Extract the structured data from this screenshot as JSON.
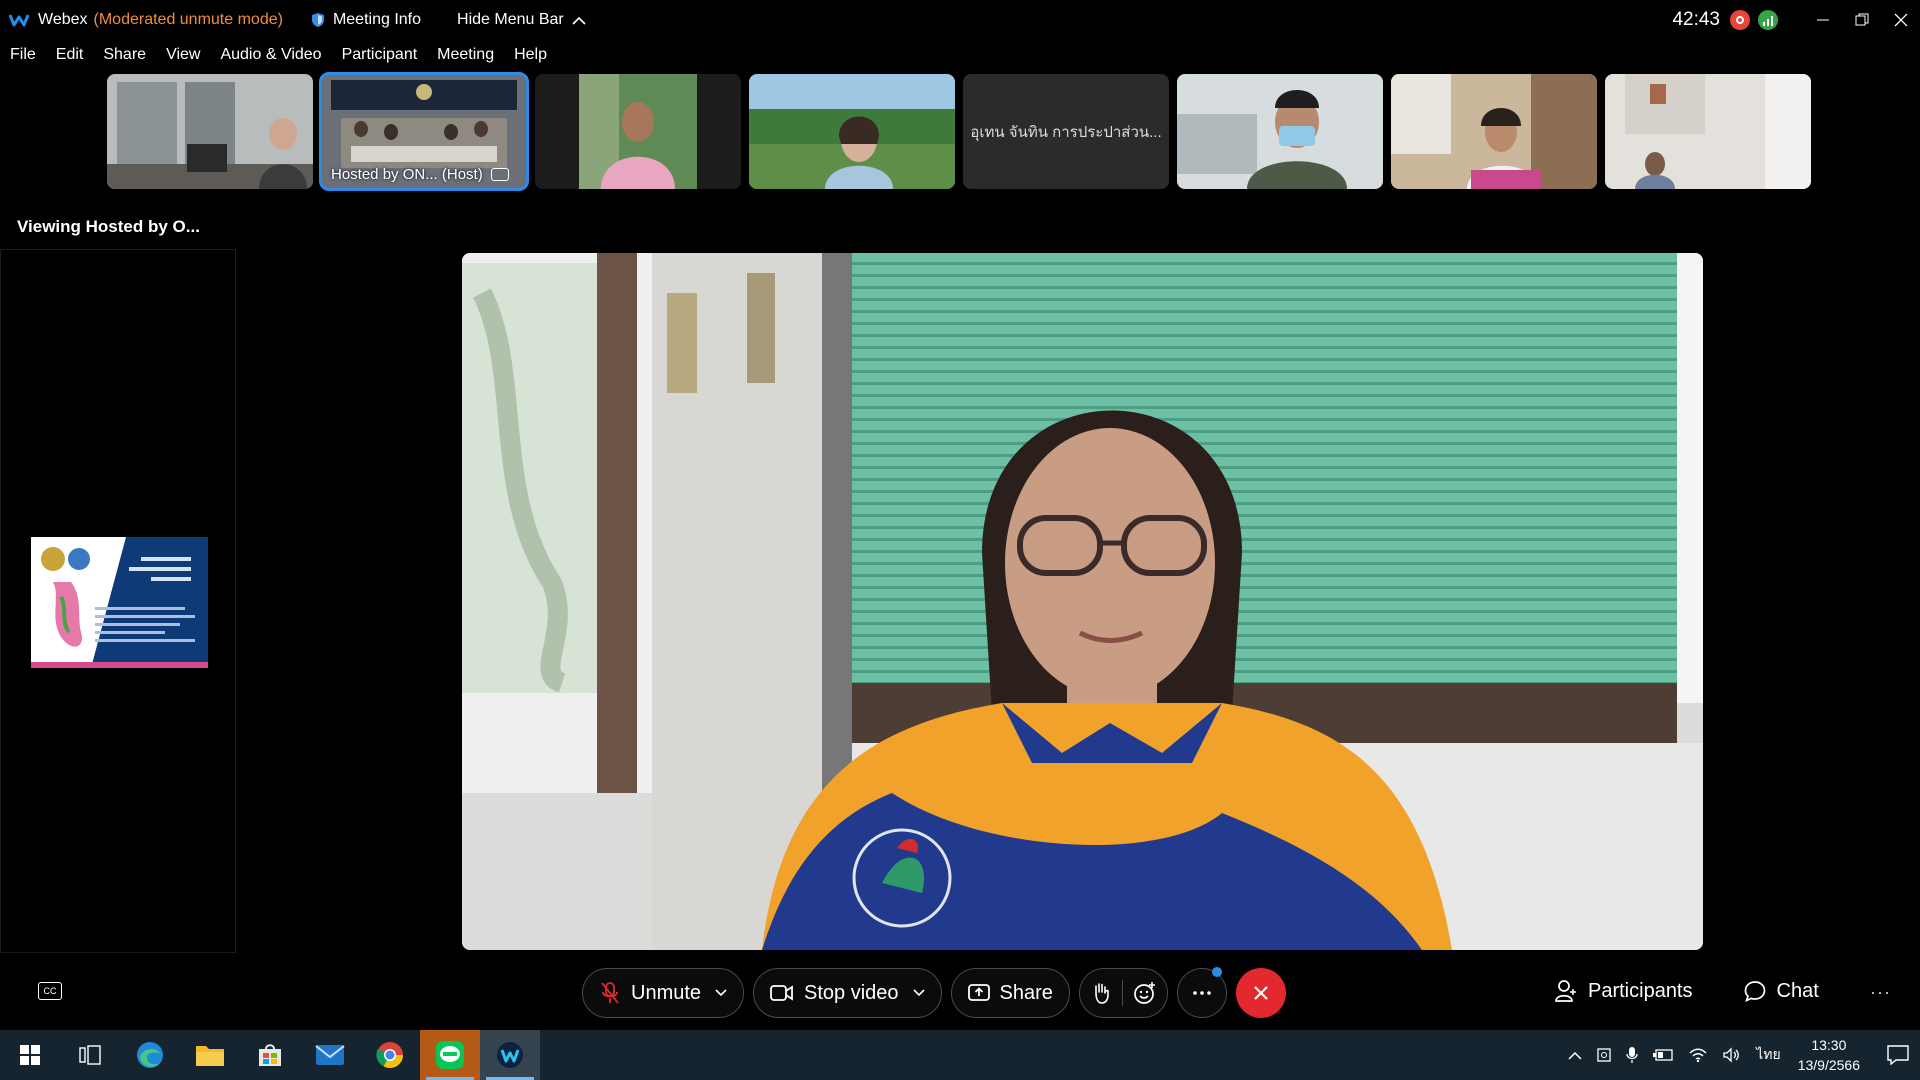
{
  "titlebar": {
    "app_name": "Webex",
    "mode": "(Moderated unmute mode)",
    "meeting_info": "Meeting Info",
    "hide_menu_bar": "Hide Menu Bar",
    "timer": "42:43"
  },
  "menu": [
    "File",
    "Edit",
    "Share",
    "View",
    "Audio & Video",
    "Participant",
    "Meeting",
    "Help"
  ],
  "filmstrip": [
    {
      "label": ""
    },
    {
      "label": "Hosted by ON... (Host)",
      "active": true
    },
    {
      "label": ""
    },
    {
      "label": ""
    },
    {
      "label": "อุเทน จันทิน การประปาส่วน...",
      "no_video": true
    },
    {
      "label": ""
    },
    {
      "label": ""
    },
    {
      "label": ""
    }
  ],
  "viewing_label": "Viewing Hosted by O...",
  "controls": {
    "unmute": "Unmute",
    "stop_video": "Stop video",
    "share": "Share",
    "participants": "Participants",
    "chat": "Chat"
  },
  "taskbar": {
    "language": "ไทย",
    "time": "13:30",
    "date": "13/9/2566"
  },
  "colors": {
    "mode_orange": "#f08d3c",
    "active_blue": "#2a8ce8",
    "end_red": "#e3282f",
    "taskbar_bg": "#16242f"
  }
}
